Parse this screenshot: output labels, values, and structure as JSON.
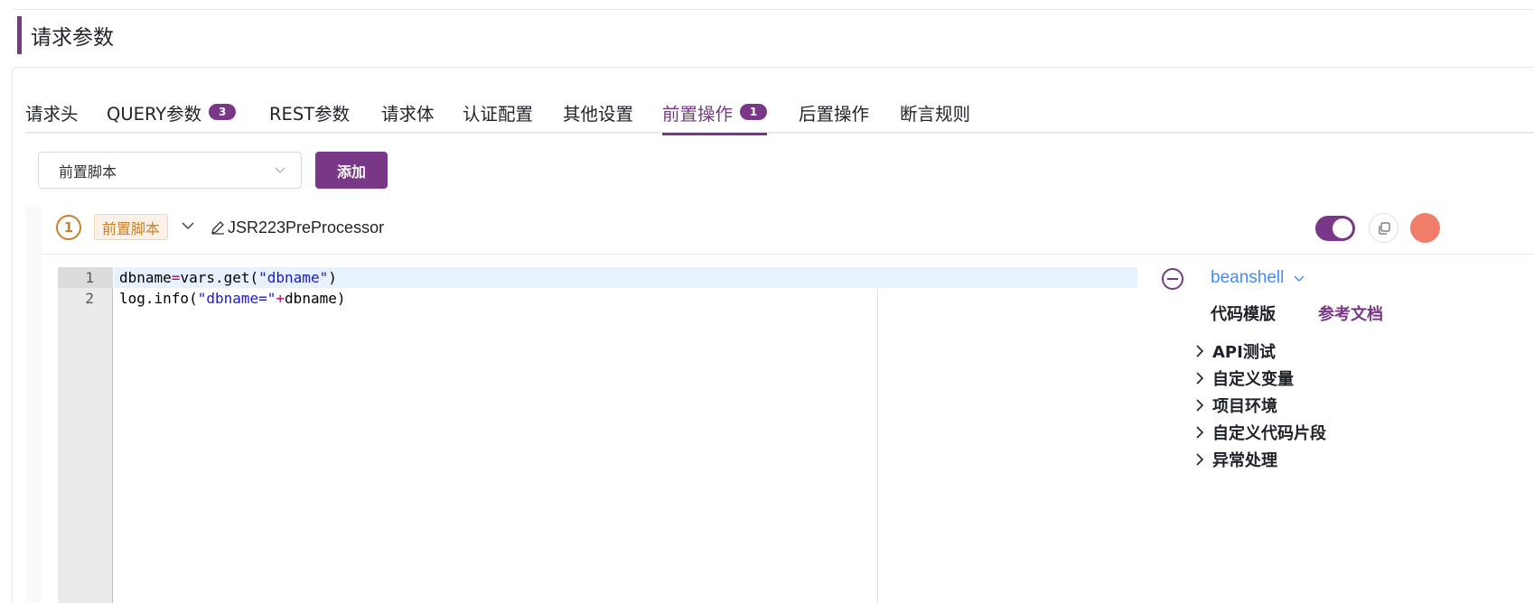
{
  "section": {
    "title": "请求参数"
  },
  "tabs": [
    {
      "label": "请求头"
    },
    {
      "label": "QUERY参数",
      "badge": "3"
    },
    {
      "label": "REST参数"
    },
    {
      "label": "请求体"
    },
    {
      "label": "认证配置"
    },
    {
      "label": "其他设置"
    },
    {
      "label": "前置操作",
      "badge": "1",
      "active": true
    },
    {
      "label": "后置操作"
    },
    {
      "label": "断言规则"
    }
  ],
  "toolbar": {
    "select_value": "前置脚本",
    "add_label": "添加"
  },
  "processor": {
    "index": "1",
    "type_label": "前置脚本",
    "name": "JSR223PreProcessor",
    "enabled": true
  },
  "editor": {
    "line_numbers": [
      "1",
      "2"
    ],
    "lines": [
      [
        {
          "t": "dbname",
          "c": ""
        },
        {
          "t": "=",
          "c": "op"
        },
        {
          "t": "vars.get(",
          "c": ""
        },
        {
          "t": "\"dbname\"",
          "c": "str"
        },
        {
          "t": ")",
          "c": ""
        }
      ],
      [
        {
          "t": "log.info(",
          "c": ""
        },
        {
          "t": "\"dbname=\"",
          "c": "str"
        },
        {
          "t": "+",
          "c": "op"
        },
        {
          "t": "dbname)",
          "c": ""
        }
      ]
    ]
  },
  "side": {
    "language": "beanshell",
    "template_label": "代码模版",
    "doc_link": "参考文档",
    "tree": [
      "API测试",
      "自定义变量",
      "项目环境",
      "自定义代码片段",
      "异常处理"
    ]
  },
  "colors": {
    "brand": "#783887",
    "tag": "#c6822d",
    "link": "#3f8cff"
  },
  "icons": [
    "chevron-down-icon",
    "edit-icon",
    "copy-icon",
    "collapse-icon",
    "chevron-right-icon"
  ]
}
